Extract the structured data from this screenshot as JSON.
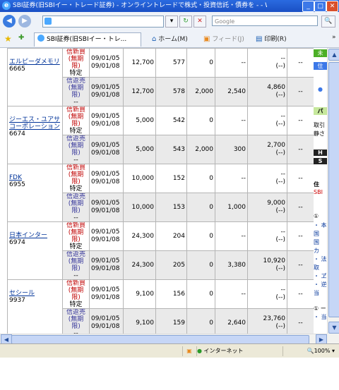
{
  "window": {
    "title": "SBI証券(旧SBIイー・トレード証券) - オンライントレードで株式・投資信託・債券を - - Wind...",
    "min_glyph": "_",
    "max_glyph": "□",
    "close_glyph": "✕"
  },
  "nav": {
    "back_glyph": "◀",
    "forward_glyph": "▶",
    "address_value": "",
    "search_placeholder": "Google",
    "search_glyph": "🔍",
    "dropdown_glyph": "▾",
    "refresh_glyph": "↻",
    "stop_glyph": "✕"
  },
  "toolbar": {
    "tab_label": "SBI証券(旧SBIイー・トレ...",
    "home_label": "ホーム(M)",
    "feed_label": "フィード(J)",
    "print_label": "印刷(R)",
    "more_glyph": "»",
    "star_glyph": "★",
    "add_fav_glyph": "✚"
  },
  "rows": [
    {
      "name": "エルピーダメモリ",
      "code": "6665",
      "buy": {
        "l1": "信新買",
        "l2": "(無期限)",
        "l3": "特定",
        "d1": "09/01/05",
        "d2": "09/01/08",
        "qty": "12,700",
        "price": "577",
        "c1": "0",
        "c2": "--",
        "l_1": "--",
        "l_2": "(--)",
        "last": "--"
      },
      "sell": {
        "l1": "信返売",
        "l2": "(無期限)",
        "l3": "--",
        "d1": "09/01/05",
        "d2": "09/01/08",
        "qty": "12,700",
        "price": "578",
        "c1": "2,000",
        "c2": "2,540",
        "l_1": "4,860",
        "l_2": "(--)",
        "last": "--"
      }
    },
    {
      "name": "ジーエス・ユアサコーポレーション",
      "code": "6674",
      "buy": {
        "l1": "信新買",
        "l2": "(無期限)",
        "l3": "特定",
        "d1": "09/01/05",
        "d2": "09/01/08",
        "qty": "5,000",
        "price": "542",
        "c1": "0",
        "c2": "--",
        "l_1": "--",
        "l_2": "(--)",
        "last": "--"
      },
      "sell": {
        "l1": "信返売",
        "l2": "(無期限)",
        "l3": "--",
        "d1": "09/01/05",
        "d2": "09/01/08",
        "qty": "5,000",
        "price": "543",
        "c1": "2,000",
        "c2": "300",
        "l_1": "2,700",
        "l_2": "(--)",
        "last": "--"
      }
    },
    {
      "name": "FDK",
      "code": "6955",
      "buy": {
        "l1": "信新買",
        "l2": "(無期限)",
        "l3": "特定",
        "d1": "09/01/05",
        "d2": "09/01/08",
        "qty": "10,000",
        "price": "152",
        "c1": "0",
        "c2": "--",
        "l_1": "--",
        "l_2": "(--)",
        "last": "--"
      },
      "sell": {
        "l1": "信返売",
        "l2": "(無期限)",
        "l3": "--",
        "d1": "09/01/05",
        "d2": "09/01/08",
        "qty": "10,000",
        "price": "153",
        "c1": "0",
        "c2": "1,000",
        "l_1": "9,000",
        "l_2": "(--)",
        "last": "--"
      }
    },
    {
      "name": "日本インター",
      "code": "6974",
      "buy": {
        "l1": "信新買",
        "l2": "(無期限)",
        "l3": "特定",
        "d1": "09/01/05",
        "d2": "09/01/08",
        "qty": "24,300",
        "price": "204",
        "c1": "0",
        "c2": "--",
        "l_1": "--",
        "l_2": "(--)",
        "last": "--"
      },
      "sell": {
        "l1": "信返売",
        "l2": "(無期限)",
        "l3": "--",
        "d1": "09/01/05",
        "d2": "09/01/08",
        "qty": "24,300",
        "price": "205",
        "c1": "0",
        "c2": "3,380",
        "l_1": "10,920",
        "l_2": "(--)",
        "last": "--"
      }
    },
    {
      "name": "セシール",
      "code": "9937",
      "buy": {
        "l1": "信新買",
        "l2": "(無期限)",
        "l3": "特定",
        "d1": "09/01/05",
        "d2": "09/01/08",
        "qty": "9,100",
        "price": "156",
        "c1": "0",
        "c2": "--",
        "l_1": "--",
        "l_2": "(--)",
        "last": "--"
      },
      "sell": {
        "l1": "信返売",
        "l2": "(無期限)",
        "l3": "--",
        "d1": "09/01/05",
        "d2": "09/01/08",
        "qty": "9,100",
        "price": "159",
        "c1": "0",
        "c2": "2,640",
        "l_1": "23,760",
        "l_2": "(--)",
        "last": "--"
      }
    }
  ],
  "right_panel": {
    "p1": "未",
    "p2": "住",
    "p3": "●",
    "p4": "パ",
    "p5": "取引",
    "p6": "静さ",
    "p7": "H",
    "p8": "S",
    "p9": "住",
    "p10": "SBI",
    "p11": "①",
    "p12": "・ 本",
    "p13": "国",
    "p14": "国",
    "p15": "カ",
    "p16": "・ 法",
    "p17": "取",
    "p18": "・ ヹ",
    "p19": "・ 逆",
    "p20": "当",
    "p21": "① ー",
    "p22": "・ 当"
  },
  "status": {
    "zone": "インターネット",
    "zoom": "100%"
  },
  "colors": {
    "title_bar": "#1a4fc4",
    "link": "#003399",
    "buy_text": "#c00000",
    "sell_text": "#333399",
    "sell_row_bg": "#eaeaea"
  }
}
